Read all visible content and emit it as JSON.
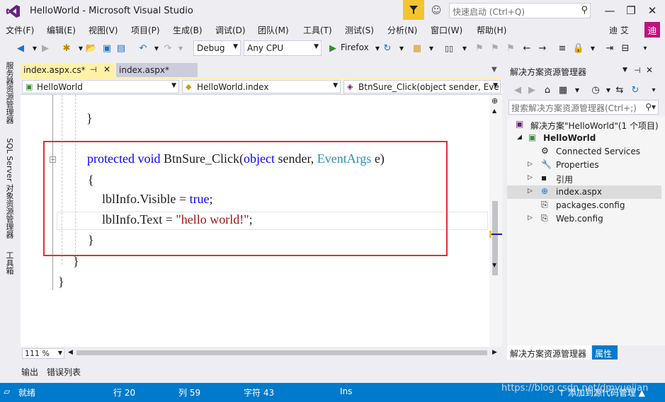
{
  "window": {
    "title": "HelloWorld - Microsoft Visual Studio",
    "quick_launch_placeholder": "快速启动 (Ctrl+Q)",
    "minimize": "—",
    "restore": "❐",
    "close": "✕"
  },
  "menu": [
    "文件(F)",
    "编辑(E)",
    "视图(V)",
    "项目(P)",
    "生成(B)",
    "调试(D)",
    "团队(M)",
    "工具(T)",
    "测试(S)",
    "分析(N)",
    "窗口(W)",
    "帮助(H)"
  ],
  "user": {
    "name": "迪 艾",
    "badge": "迪"
  },
  "toolbar": {
    "config": "Debug",
    "platform": "Any CPU",
    "run_target": "Firefox"
  },
  "left_rail": {
    "server_explorer": "服务器资源管理器",
    "sql_explorer": "SQL Server 对象资源管理器",
    "toolbox": "工具箱"
  },
  "editor_tabs": [
    {
      "label": "index.aspx.cs*"
    },
    {
      "label": "index.aspx*"
    }
  ],
  "navbar": {
    "project": "HelloWorld",
    "class": "HelloWorld.index",
    "member": "BtnSure_Click(object sender, Eve"
  },
  "code": {
    "brace_close_inner": "}",
    "sig_protected": "protected",
    "sig_void": "void",
    "sig_name": "BtnSure_Click(",
    "sig_object": "object",
    "sig_sender": " sender, ",
    "sig_eventargs": "EventArgs",
    "sig_end": " e)",
    "open_brace": "{",
    "l1_prefix": "lblInfo.Visible = ",
    "l1_true": "true",
    "l1_end": ";",
    "l2_prefix": "lblInfo.Text = ",
    "l2_str": "\"hello world!\"",
    "l2_end": ";",
    "close_brace": "}",
    "class_close": "}",
    "ns_close": "}"
  },
  "zoom": "111 %",
  "bottom_tabs": [
    "输出",
    "错误列表"
  ],
  "solution_explorer": {
    "title": "解决方案资源管理器",
    "search_placeholder": "搜索解决方案资源管理器(Ctrl+;)",
    "items": [
      {
        "label": "解决方案\"HelloWorld\"(1 个项目)",
        "icon": "solution-icon"
      },
      {
        "label": "HelloWorld",
        "icon": "csharp-project-icon"
      },
      {
        "label": "Connected Services",
        "icon": "connected-services-icon"
      },
      {
        "label": "Properties",
        "icon": "wrench-icon"
      },
      {
        "label": "引用",
        "icon": "references-icon"
      },
      {
        "label": "index.aspx",
        "icon": "web-file-icon"
      },
      {
        "label": "packages.config",
        "icon": "config-file-icon"
      },
      {
        "label": "Web.config",
        "icon": "config-file-icon"
      }
    ],
    "tabs": [
      "解决方案资源管理器",
      "属性"
    ]
  },
  "status": {
    "ready": "就绪",
    "line": "行 20",
    "col": "列 59",
    "char": "字符 43",
    "mode": "Ins",
    "publish": "↑ 添加到源代码管理 ▲"
  },
  "watermark": "https://blog.csdn.net/dmyuejian",
  "colors": {
    "accent": "#007acc",
    "active_tab": "#fff1a8",
    "highlight_box": "#e03030",
    "keyword": "#0000ff",
    "type": "#2b91af",
    "string": "#a31515"
  }
}
